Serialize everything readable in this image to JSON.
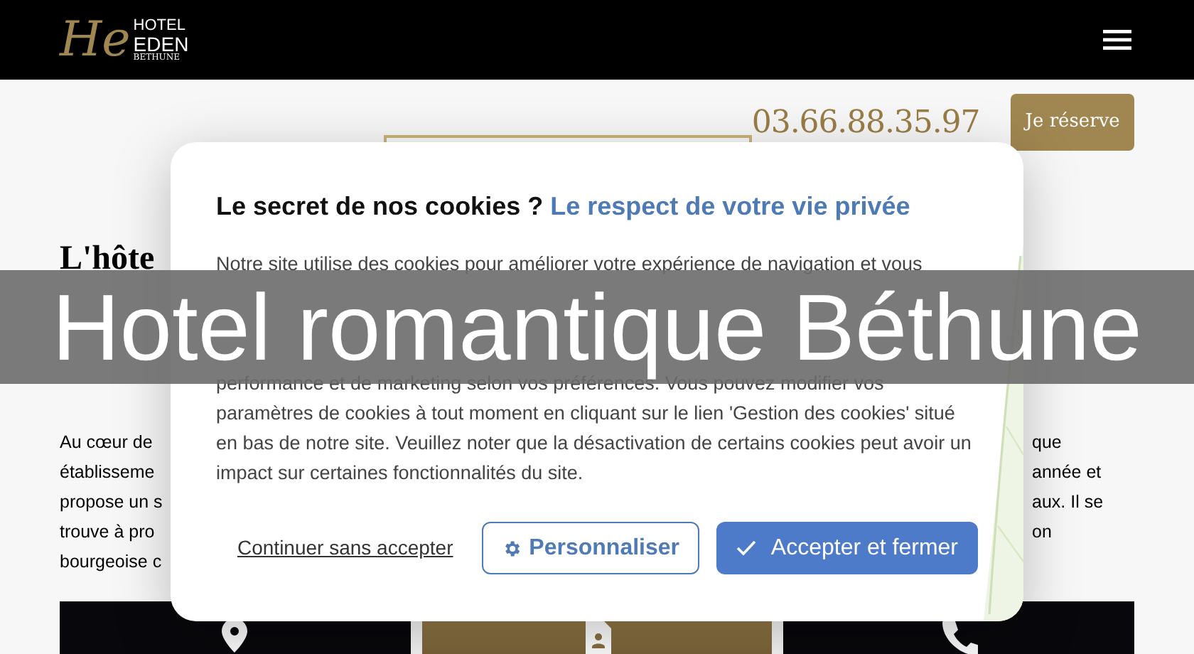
{
  "header": {
    "logo": {
      "monogram": "He",
      "line_1": "HOTEL",
      "line_2": "EDEN",
      "line_3": "BETHUNE"
    }
  },
  "contact": {
    "phone": "03.66.88.35.97",
    "reserve_button": "Je réserve"
  },
  "page": {
    "heading": "L'hôte",
    "left_lines": [
      "Au cœur de",
      "établisseme",
      "propose un s",
      "trouve à pro",
      "bourgeoise c"
    ],
    "right_lines": [
      "que",
      "année et",
      "aux. Il se",
      "on"
    ],
    "tiles": [
      {
        "kind": "location",
        "selected": false
      },
      {
        "kind": "contact",
        "selected": true
      },
      {
        "kind": "phone",
        "selected": false
      }
    ]
  },
  "cookie_dialog": {
    "title": "Le secret de nos cookies ?",
    "subtitle": "Le respect de votre vie privée",
    "first_line": "Notre site utilise des cookies pour améliorer votre expérience de navigation et vous",
    "text": "performance et de marketing selon vos préférences. Vous pouvez modifier vos paramètres de cookies à tout moment en cliquant sur le lien 'Gestion des cookies' situé en bas de notre site. Veuillez noter que la désactivation de certains cookies peut avoir un impact sur certaines fonctionnalités du site.",
    "buttons": [
      {
        "kind": "link",
        "label": "Continuer sans accepter"
      },
      {
        "kind": "outline",
        "label": "Personnaliser"
      },
      {
        "kind": "primary",
        "label": "Accepter et fermer"
      }
    ]
  },
  "caption": "Hotel romantique Béthune"
}
